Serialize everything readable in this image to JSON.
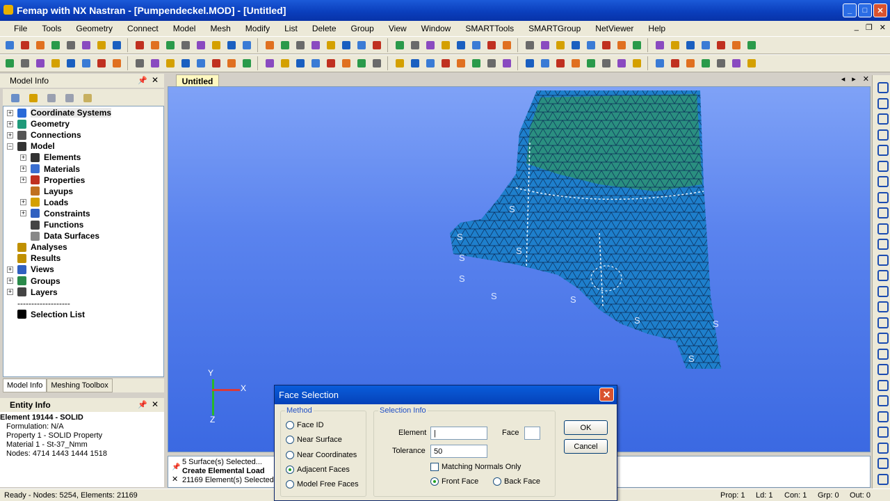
{
  "app": {
    "title": "Femap with NX Nastran - [Pumpendeckel.MOD] - [Untitled]"
  },
  "menu": [
    "File",
    "Tools",
    "Geometry",
    "Connect",
    "Model",
    "Mesh",
    "Modify",
    "List",
    "Delete",
    "Group",
    "View",
    "Window",
    "SMARTTools",
    "SMARTGroup",
    "NetViewer",
    "Help"
  ],
  "model_info": {
    "title": "Model Info",
    "tree": [
      {
        "label": "Coordinate Systems",
        "icon": "coordinate-systems-icon",
        "color": "#2a6ad8"
      },
      {
        "label": "Geometry",
        "icon": "geometry-icon",
        "color": "#1f9a7a"
      },
      {
        "label": "Connections",
        "icon": "connections-icon",
        "color": "#555555"
      },
      {
        "label": "Model",
        "icon": "model-icon",
        "color": "#333333"
      },
      {
        "label": "Elements",
        "icon": "elements-icon",
        "color": "#333333"
      },
      {
        "label": "Materials",
        "icon": "materials-icon",
        "color": "#3a6ed0"
      },
      {
        "label": "Properties",
        "icon": "properties-icon",
        "color": "#c03020"
      },
      {
        "label": "Layups",
        "icon": "layups-icon",
        "color": "#c07020"
      },
      {
        "label": "Loads",
        "icon": "loads-icon",
        "color": "#d4a000"
      },
      {
        "label": "Constraints",
        "icon": "constraints-icon",
        "color": "#3060c0"
      },
      {
        "label": "Functions",
        "icon": "functions-icon",
        "color": "#444444"
      },
      {
        "label": "Data Surfaces",
        "icon": "data-surfaces-icon",
        "color": "#888888"
      },
      {
        "label": "Analyses",
        "icon": "analyses-icon",
        "color": "#c09000"
      },
      {
        "label": "Results",
        "icon": "results-icon",
        "color": "#c09000"
      },
      {
        "label": "Views",
        "icon": "views-icon",
        "color": "#3060c0"
      },
      {
        "label": "Groups",
        "icon": "groups-icon",
        "color": "#2a8a4a"
      },
      {
        "label": "Layers",
        "icon": "layers-icon",
        "color": "#444444"
      },
      {
        "label": "-------------------",
        "icon": "",
        "color": ""
      },
      {
        "label": "Selection List",
        "icon": "selection-list-icon",
        "color": "#000000"
      }
    ],
    "tabs": [
      "Model Info",
      "Meshing Toolbox"
    ]
  },
  "entity_info": {
    "title": "Entity Info",
    "header": "Element 19144 - SOLID",
    "lines": [
      "Formulation: N/A",
      "Property 1 - SOLID Property",
      "Material 1 - St-37_Nmm",
      "Nodes: 4714 1443 1444 1518"
    ]
  },
  "document_tab": "Untitled",
  "axis": {
    "x": "X",
    "y": "Y",
    "z": "Z"
  },
  "messages": [
    "5 Surface(s) Selected...",
    "Create Elemental Load",
    "21169 Element(s) Selected"
  ],
  "status": {
    "ready": "Ready - Nodes: 5254,  Elements: 21169",
    "prop": "Prop: 1",
    "ld": "Ld: 1",
    "con": "Con: 1",
    "grp": "Grp: 0",
    "out": "Out: 0"
  },
  "dialog": {
    "title": "Face Selection",
    "method_legend": "Method",
    "methods": [
      {
        "label": "Face ID",
        "checked": false
      },
      {
        "label": "Near Surface",
        "checked": false
      },
      {
        "label": "Near Coordinates",
        "checked": false
      },
      {
        "label": "Adjacent Faces",
        "checked": true
      },
      {
        "label": "Model Free Faces",
        "checked": false
      }
    ],
    "selection_legend": "Selection Info",
    "element_label": "Element",
    "element_value": "|",
    "face_label": "Face",
    "face_value": "",
    "tolerance_label": "Tolerance",
    "tolerance_value": "50",
    "matching_normals": "Matching Normals Only",
    "front_face": "Front Face",
    "back_face": "Back Face",
    "ok": "OK",
    "cancel": "Cancel"
  },
  "colors": {
    "title_blue": "#0a3dbb",
    "viewport_top": "#7fa2f7",
    "viewport_bottom": "#3b69e2",
    "mesh_blue": "#1a78c8",
    "mesh_green": "#2a9a6a"
  }
}
